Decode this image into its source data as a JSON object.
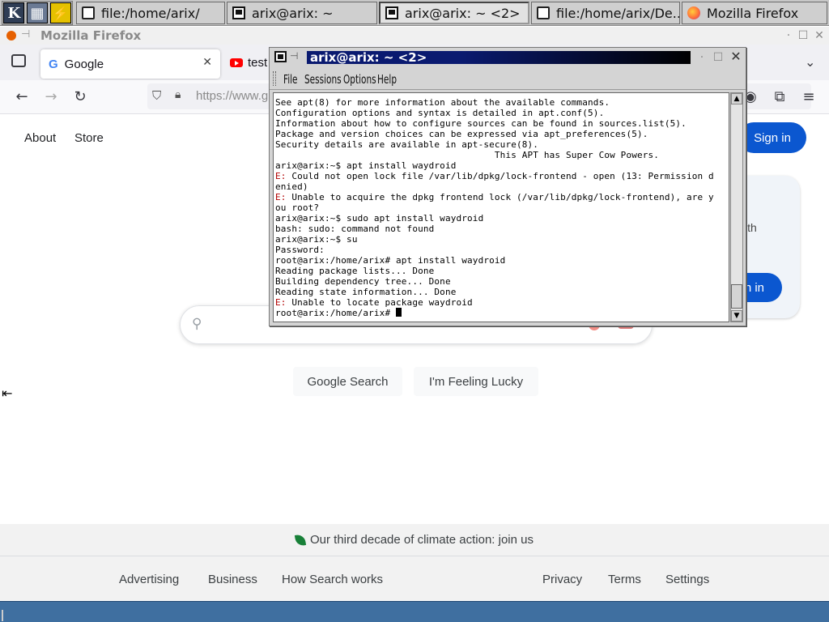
{
  "taskbar": {
    "tasks": [
      {
        "label": "file:/home/arix/"
      },
      {
        "label": "arix@arix: ~"
      },
      {
        "label": "arix@arix: ~ <2>"
      },
      {
        "label": "file:/home/arix/De..."
      },
      {
        "label": "Mozilla Firefox"
      }
    ]
  },
  "firefox": {
    "window_title": "Mozilla Firefox",
    "tabs": [
      {
        "label": "Google"
      },
      {
        "label": "test"
      }
    ],
    "url": "https://www.g",
    "page": {
      "header_links": [
        "About",
        "Store"
      ],
      "sign_in": "Sign in",
      "promo_text": "ith",
      "promo_button": "n in",
      "buttons": [
        "Google Search",
        "I'm Feeling Lucky"
      ],
      "climate": "Our third decade of climate action: join us",
      "footer_left": [
        "Advertising",
        "Business",
        "How Search works"
      ],
      "footer_right": [
        "Privacy",
        "Terms",
        "Settings"
      ]
    }
  },
  "konsole": {
    "title": "arix@arix: ~ <2>",
    "menu": [
      "File",
      "Sessions",
      "Options",
      "Help"
    ],
    "lines": [
      {
        "prefix": "",
        "text": "See apt(8) for more information about the available commands."
      },
      {
        "prefix": "",
        "text": "Configuration options and syntax is detailed in apt.conf(5)."
      },
      {
        "prefix": "",
        "text": "Information about how to configure sources can be found in sources.list(5)."
      },
      {
        "prefix": "",
        "text": "Package and version choices can be expressed via apt_preferences(5)."
      },
      {
        "prefix": "",
        "text": "Security details are available in apt-secure(8)."
      },
      {
        "prefix": "",
        "text": "                                        This APT has Super Cow Powers."
      },
      {
        "prefix": "",
        "text": "arix@arix:~$ apt install waydroid"
      },
      {
        "prefix": "E:",
        "text": " Could not open lock file /var/lib/dpkg/lock-frontend - open (13: Permission d"
      },
      {
        "prefix": "",
        "text": "enied)"
      },
      {
        "prefix": "E:",
        "text": " Unable to acquire the dpkg frontend lock (/var/lib/dpkg/lock-frontend), are y"
      },
      {
        "prefix": "",
        "text": "ou root?"
      },
      {
        "prefix": "",
        "text": "arix@arix:~$ sudo apt install waydroid"
      },
      {
        "prefix": "",
        "text": "bash: sudo: command not found"
      },
      {
        "prefix": "",
        "text": "arix@arix:~$ su"
      },
      {
        "prefix": "",
        "text": "Password:"
      },
      {
        "prefix": "",
        "text": "root@arix:/home/arix# apt install waydroid"
      },
      {
        "prefix": "",
        "text": "Reading package lists... Done"
      },
      {
        "prefix": "",
        "text": "Building dependency tree... Done"
      },
      {
        "prefix": "",
        "text": "Reading state information... Done"
      },
      {
        "prefix": "E:",
        "text": " Unable to locate package waydroid"
      },
      {
        "prefix": "",
        "text": "root@arix:/home/arix# "
      }
    ]
  }
}
